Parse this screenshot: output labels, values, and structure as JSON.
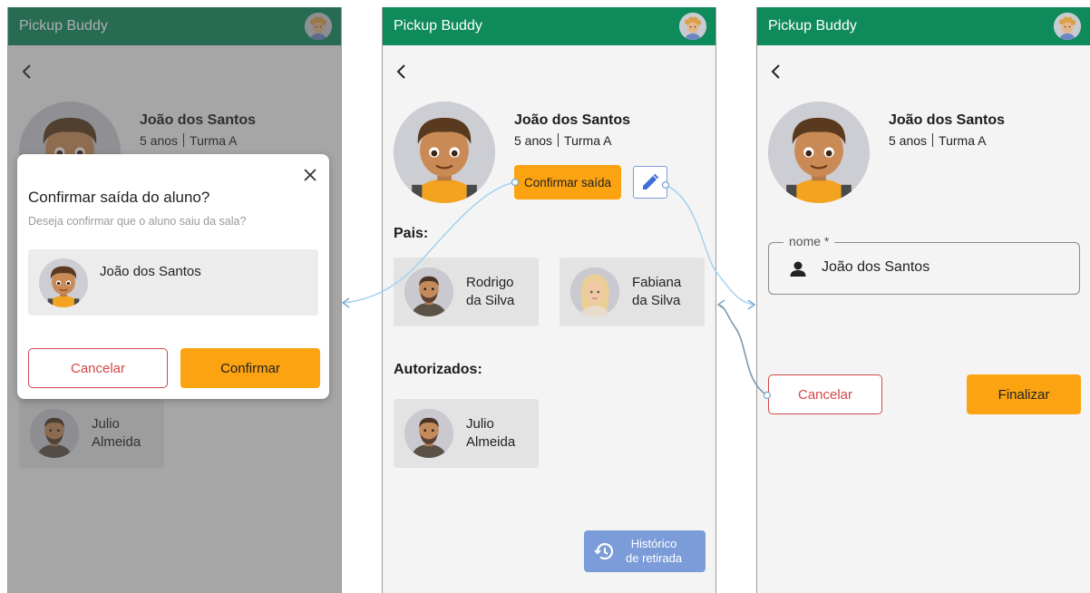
{
  "app": {
    "title": "Pickup Buddy"
  },
  "child": {
    "name": "João dos Santos",
    "age": "5 anos",
    "class": "Turma A"
  },
  "screen1": {
    "parents_partial": [
      {
        "name_line1": "Julio",
        "name_line2": "Almeida"
      }
    ],
    "modal": {
      "title": "Confirmar saída do aluno?",
      "subtitle": "Deseja confirmar que o aluno saiu da sala?",
      "child_name": "João dos Santos",
      "cancel_label": "Cancelar",
      "confirm_label": "Confirmar"
    }
  },
  "screen2": {
    "confirm_exit_label": "Confirmar saída",
    "parents_title": "Pais:",
    "parents": [
      {
        "name_line1": "Rodrigo",
        "name_line2": "da Silva"
      },
      {
        "name_line1": "Fabiana",
        "name_line2": "da Silva"
      }
    ],
    "authorized_title": "Autorizados:",
    "authorized": [
      {
        "name_line1": "Julio",
        "name_line2": "Almeida"
      }
    ],
    "history_label_line1": "Histórico",
    "history_label_line2": "de retirada"
  },
  "screen3": {
    "field_label": "nome *",
    "field_value": "João dos Santos",
    "cancel_label": "Cancelar",
    "finish_label": "Finalizar"
  },
  "colors": {
    "appbar": "#0e8a5b",
    "accent_orange": "#fca311",
    "danger_red": "#d14848",
    "history_blue": "#7c9cd9"
  },
  "icons": [
    "back-arrow-icon",
    "close-icon",
    "edit-pencil-icon",
    "person-icon",
    "history-icon",
    "avatar-icon"
  ]
}
